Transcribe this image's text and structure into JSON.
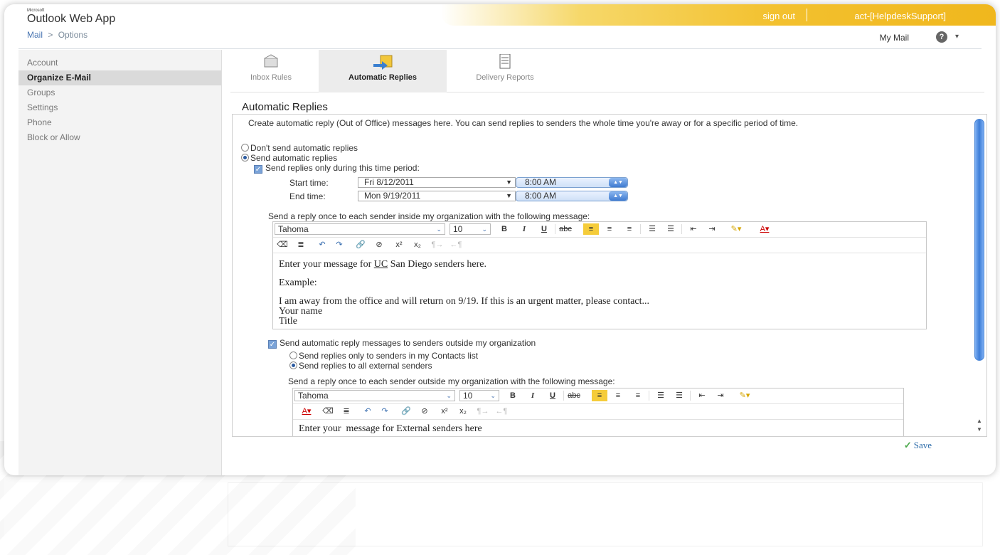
{
  "header": {
    "brand_small": "Microsoft",
    "app_title": "Outlook Web App",
    "sign_out": "sign out",
    "account": "act-[HelpdeskSupport]",
    "my_mail": "My Mail",
    "help": "?"
  },
  "breadcrumb": {
    "root": "Mail",
    "separator": ">",
    "current": "Options"
  },
  "sidebar": {
    "items": [
      {
        "label": "Account"
      },
      {
        "label": "Organize E-Mail",
        "selected": true
      },
      {
        "label": "Groups"
      },
      {
        "label": "Settings"
      },
      {
        "label": "Phone"
      },
      {
        "label": "Block or Allow"
      }
    ]
  },
  "tabs": [
    {
      "label": "Inbox Rules",
      "icon": "inbox-rules-icon"
    },
    {
      "label": "Automatic Replies",
      "icon": "automatic-replies-icon",
      "selected": true
    },
    {
      "label": "Delivery Reports",
      "icon": "delivery-reports-icon"
    }
  ],
  "content": {
    "title": "Automatic Replies",
    "description": "Create automatic reply (Out of Office) messages here. You can send replies to senders the whole time you're away or for a specific period of time.",
    "radio_dont_send": "Don't send automatic replies",
    "radio_send": "Send automatic replies",
    "check_time_period": "Send replies only during this time period:",
    "start_label": "Start time:",
    "start_date": "Fri 8/12/2011",
    "start_time": "8:00 AM",
    "end_label": "End time:",
    "end_date": "Mon 9/19/2011",
    "end_time": "8:00 AM",
    "inside_label": "Send a reply once to each sender inside my organization with the following message:",
    "editor_font": "Tahoma",
    "editor_size": "10",
    "inside_msg_line1_pre": "Enter your message for ",
    "inside_msg_line1_uc": "UC",
    "inside_msg_line1_post": " San Diego senders here.",
    "inside_msg_line2": "Example:",
    "inside_msg_line3": "I am away from the office and will return on 9/19. If this is an urgent matter, please contact...",
    "inside_msg_line4": "Your name",
    "inside_msg_line5": "Title",
    "check_outside": "Send automatic reply messages to senders outside my organization",
    "radio_contacts": "Send replies only to senders in my Contacts list",
    "radio_all_external": "Send replies to all external senders",
    "outside_label": "Send a reply once to each sender outside my organization with the following message:",
    "outside_msg": "Enter your  message for External senders here"
  },
  "save_label": "Save",
  "colors": {
    "accent_gold": "#f3c12f",
    "selection_blue": "#3c7dd8",
    "highlight": "#f5cc3a"
  }
}
